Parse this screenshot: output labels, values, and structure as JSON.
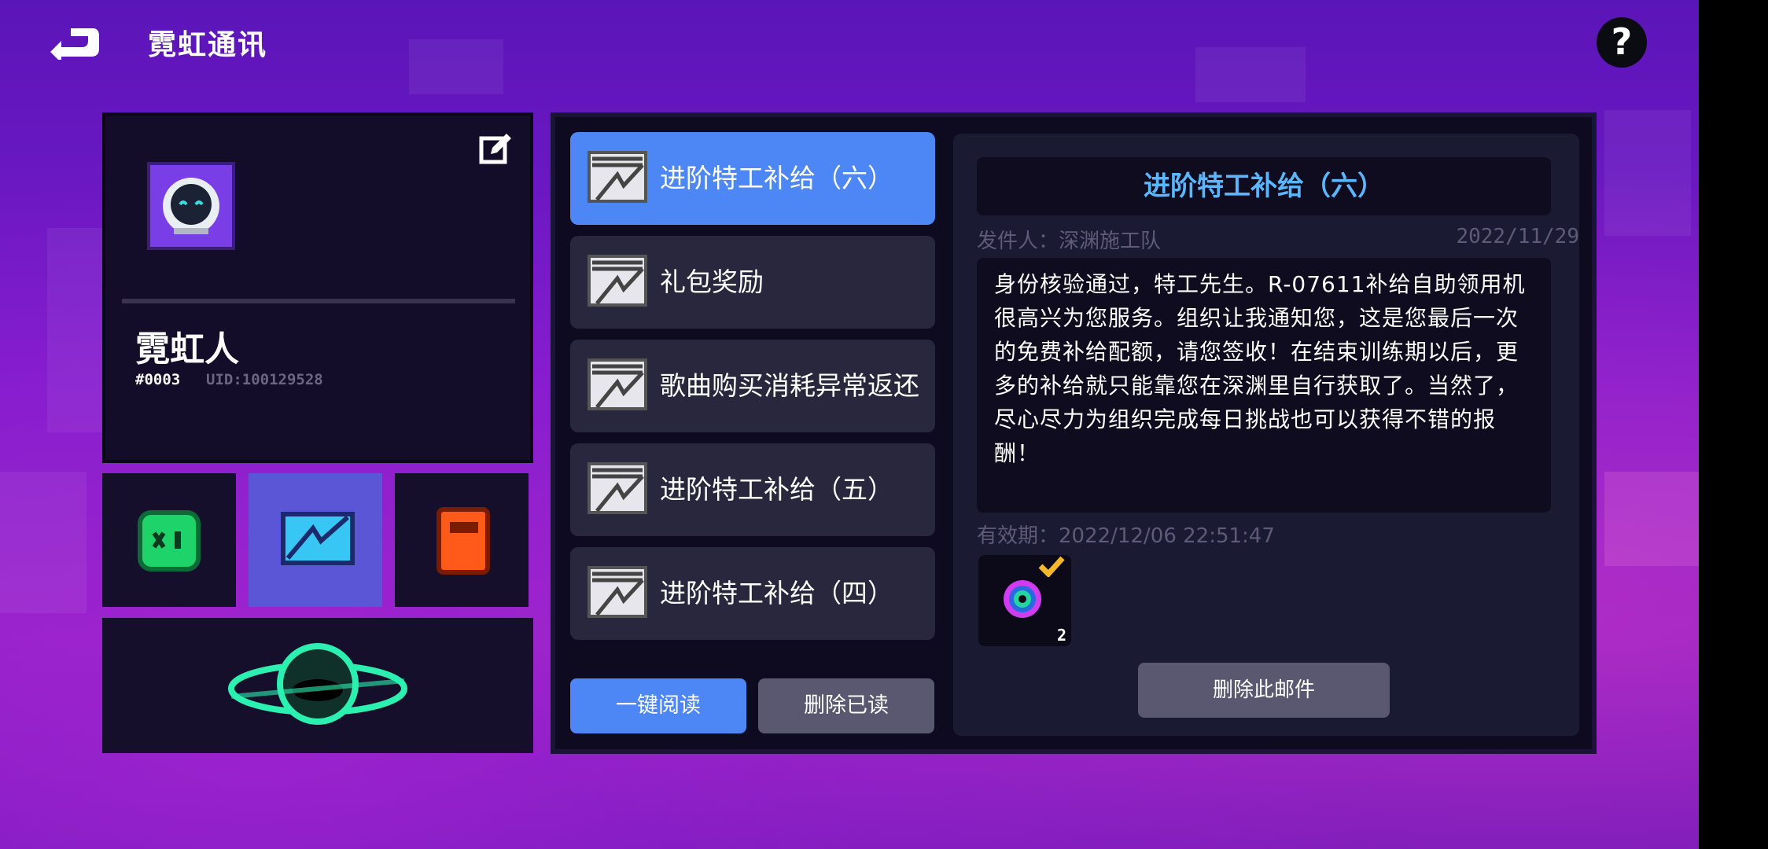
{
  "header": {
    "title": "霓虹通讯",
    "help_label": "?"
  },
  "profile": {
    "name": "霓虹人",
    "tag": "#0003",
    "uid": "UID:100129528"
  },
  "mail_list": [
    {
      "label": "进阶特工补给（六）",
      "selected": true
    },
    {
      "label": "礼包奖励",
      "selected": false
    },
    {
      "label": "歌曲购买消耗异常返还",
      "selected": false
    },
    {
      "label": "进阶特工补给（五）",
      "selected": false
    },
    {
      "label": "进阶特工补给（四）",
      "selected": false
    }
  ],
  "buttons": {
    "read_all": "一键阅读",
    "delete_read": "删除已读",
    "delete_this": "删除此邮件"
  },
  "detail": {
    "title": "进阶特工补给（六）",
    "sender": "发件人：深渊施工队",
    "date": "2022/11/29",
    "body": "身份核验通过，特工先生。R-07611补给自助领用机很高兴为您服务。组织让我通知您，这是您最后一次的免费补给配额，请您签收！在结束训练期以后，更多的补给就只能靠您在深渊里自行获取了。当然了，尽心尽力为组织完成每日挑战也可以获得不错的报酬！",
    "expiry": "有效期：2022/12/06 22:51:47",
    "reward_count": "2",
    "reward_claimed": true
  },
  "colors": {
    "accent_blue": "#4d86f5",
    "title_blue": "#5ab6ff",
    "panel_dark": "#130d2a",
    "button_gray": "#5a5870",
    "game_green": "#1fd36b",
    "book_orange": "#ff5a1a",
    "planet_teal": "#2bf0b0"
  },
  "icons": {
    "back": "back-arrow-icon",
    "help": "help-icon",
    "edit": "edit-icon",
    "mail": "mail-envelope-icon",
    "game": "gamepad-icon",
    "book": "book-icon",
    "planet": "planet-icon",
    "reward": "vinyl-disc-icon",
    "check": "check-icon"
  }
}
